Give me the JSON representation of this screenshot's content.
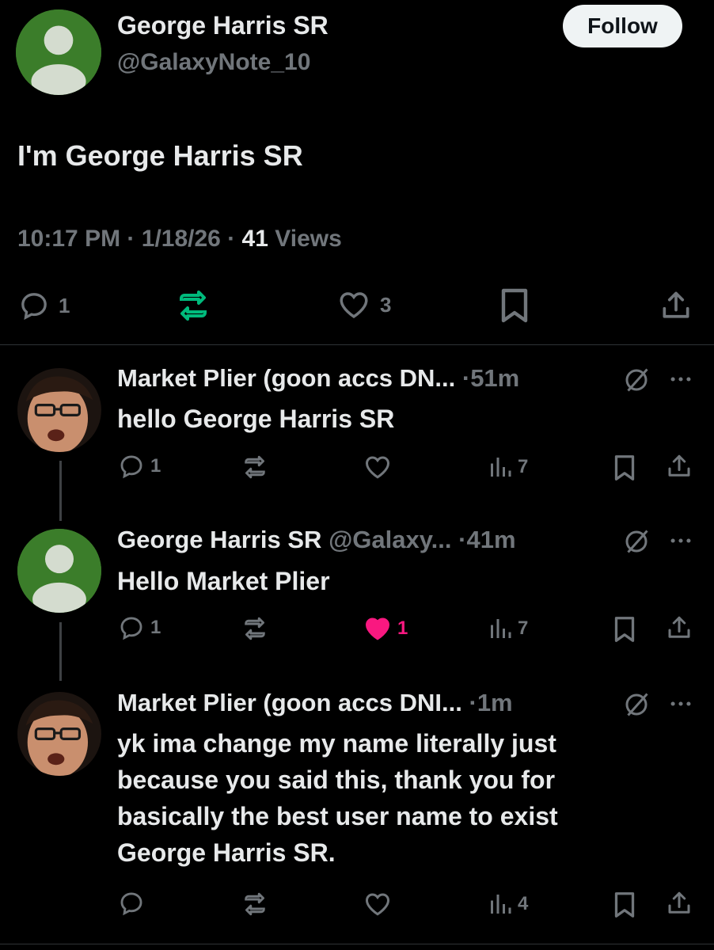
{
  "main_post": {
    "author_name": "George Harris SR",
    "author_handle": "@GalaxyNote_10",
    "follow_label": "Follow",
    "text": "I'm George Harris SR",
    "time": "10:17 PM",
    "date": "1/18/26",
    "views_count": "41",
    "views_label": "Views",
    "separator": "·",
    "reply_count": "1",
    "like_count": "3"
  },
  "replies": [
    {
      "author_name": "Market Plier (goon accs DN...",
      "separator": "·",
      "time": "51m",
      "lines": [
        "hello George Harris SR"
      ],
      "reply_count": "1",
      "repost_count": "",
      "like_count": "",
      "views_count": "7",
      "liked": false
    },
    {
      "author_name": "George Harris SR",
      "author_handle": "@Galaxy...",
      "separator": "·",
      "time": "41m",
      "lines": [
        "Hello Market Plier"
      ],
      "reply_count": "1",
      "repost_count": "",
      "like_count": "1",
      "views_count": "7",
      "liked": true
    },
    {
      "author_name": "Market Plier (goon accs DNI...",
      "separator": "·",
      "time": "1m",
      "lines": [
        "yk ima change my name literally just",
        "because you said this, thank you for",
        "basically the best user name to exist",
        "George Harris SR."
      ],
      "reply_count": "",
      "repost_count": "",
      "like_count": "",
      "views_count": "4",
      "liked": false
    }
  ],
  "colors": {
    "background": "#000000",
    "text_primary": "#e7e9ea",
    "text_muted": "#71767b",
    "repost_active": "#00ba7c",
    "like_active": "#f91880",
    "avatar_green": "#3b7d2a"
  },
  "icons": [
    "reply-icon",
    "repost-icon",
    "like-icon",
    "bookmark-icon",
    "share-icon",
    "views-icon",
    "grok-icon",
    "more-icon"
  ]
}
